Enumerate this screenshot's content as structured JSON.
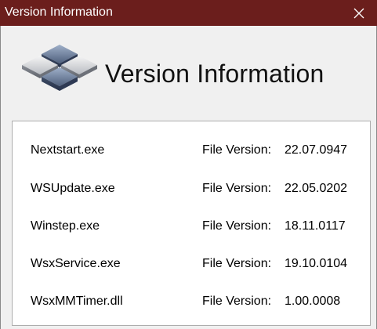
{
  "window": {
    "title": "Version Information",
    "close_glyph": "✕"
  },
  "header": {
    "logo_icon": "winstep-logo-icon",
    "heading": "Version Information"
  },
  "files": [
    {
      "name": "Nextstart.exe",
      "label": "File Version:",
      "version": "22.07.0947"
    },
    {
      "name": "WSUpdate.exe",
      "label": "File Version:",
      "version": "22.05.0202"
    },
    {
      "name": "Winstep.exe",
      "label": "File Version:",
      "version": "18.11.0117"
    },
    {
      "name": "WsxService.exe",
      "label": "File Version:",
      "version": "19.10.0104"
    },
    {
      "name": "WsxMMTimer.dll",
      "label": "File Version:",
      "version": "1.00.0008"
    }
  ],
  "colors": {
    "titlebar": "#6b1e1c",
    "title_text": "#ffffff",
    "background": "#f0f0f0",
    "panel": "#ffffff"
  }
}
